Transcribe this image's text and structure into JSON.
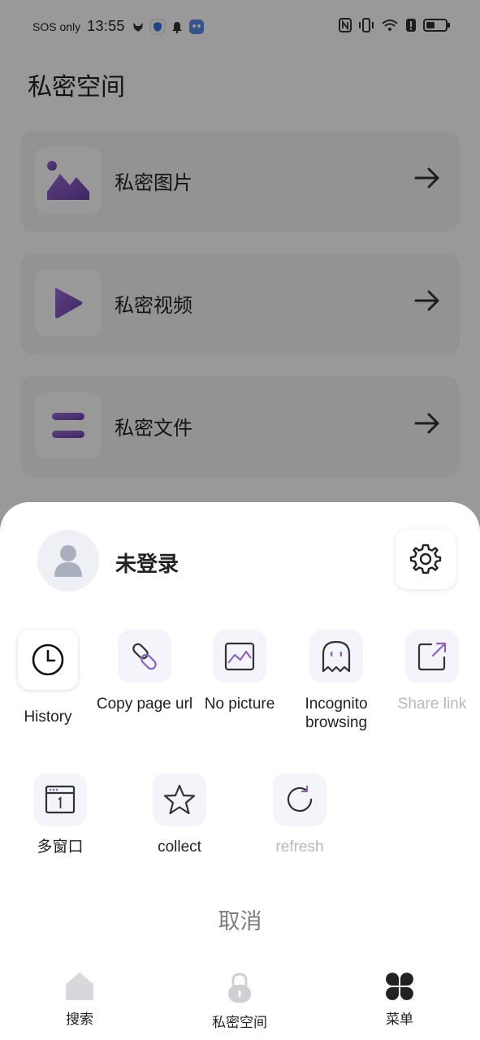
{
  "status_bar": {
    "carrier": "SOS only",
    "time": "13:55"
  },
  "page": {
    "title": "私密空间"
  },
  "cards": [
    {
      "label": "私密图片",
      "icon": "image-icon"
    },
    {
      "label": "私密视频",
      "icon": "play-icon"
    },
    {
      "label": "私密文件",
      "icon": "file-icon"
    }
  ],
  "sheet": {
    "user": {
      "name": "未登录"
    },
    "actions_row1": [
      {
        "label": "History",
        "icon": "clock-icon",
        "enabled": true
      },
      {
        "label": "Copy page url",
        "icon": "link-icon",
        "enabled": true
      },
      {
        "label": "No picture",
        "icon": "no-picture-icon",
        "enabled": true
      },
      {
        "label": "Incognito browsing",
        "icon": "ghost-icon",
        "enabled": true
      },
      {
        "label": "Share link",
        "icon": "share-icon",
        "enabled": false
      }
    ],
    "actions_row2": [
      {
        "label": "多窗口",
        "icon": "window-icon",
        "enabled": true
      },
      {
        "label": "collect",
        "icon": "star-icon",
        "enabled": true
      },
      {
        "label": "refresh",
        "icon": "refresh-icon",
        "enabled": false
      }
    ],
    "cancel_label": "取消"
  },
  "bottom_nav": [
    {
      "label": "搜索",
      "icon": "home-icon"
    },
    {
      "label": "私密空间",
      "icon": "lock-icon"
    },
    {
      "label": "菜单",
      "icon": "menu-grid-icon"
    }
  ],
  "colors": {
    "accent_purple": "#8a63c4",
    "overlay": "rgba(0,0,0,0.40)",
    "disabled_text": "#b9b9bd"
  }
}
